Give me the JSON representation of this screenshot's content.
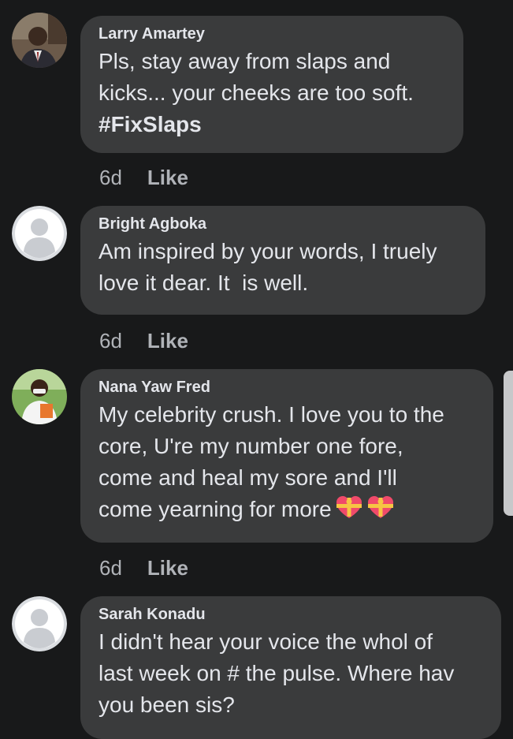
{
  "comments": [
    {
      "author": "Larry Amartey",
      "text": "Pls, stay away from slaps and\nkicks... your cheeks are too soft.",
      "hashtag": "#FixSlaps",
      "time": "6d",
      "like": "Like",
      "avatar": "profile-photo"
    },
    {
      "author": "Bright Agboka",
      "text": "Am inspired by your words, I truely\nlove it dear. It  is well.",
      "time": "6d",
      "like": "Like",
      "avatar": "default-avatar-icon"
    },
    {
      "author": "Nana Yaw Fred",
      "text": "My celebrity crush. I love you to the\ncore, U're my number one fore,\ncome and heal my sore and I'll\ncome yearning for more",
      "emoji": "heart-with-ribbon-emoji",
      "time": "6d",
      "like": "Like",
      "avatar": "profile-photo"
    },
    {
      "author": "Sarah Konadu",
      "text": "I didn't hear your voice the whol of\nlast week on # the pulse. Where hav\nyou been sis?",
      "avatar": "default-avatar-icon"
    }
  ],
  "colors": {
    "background": "#18191a",
    "bubble": "#3a3b3c",
    "primary_text": "#e4e6eb",
    "secondary_text": "#b0b3b8"
  }
}
